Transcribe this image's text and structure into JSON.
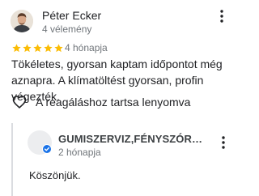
{
  "review": {
    "reviewer_name": "Péter Ecker",
    "review_count": "4 vélemény",
    "rating": 5,
    "rating_max": 5,
    "time_ago": "4 hónapja",
    "text": "Tökéletes, gyorsan kaptam időpontot még aznapra. A klímatöltést gyorsan, profin végezték.",
    "like_label": "A reagáláshoz tartsa lenyomva",
    "star_color": "#fbbc04"
  },
  "owner_reply": {
    "owner_name": "GUMISZERVIZ,FÉNYSZÓRÓ FEL…",
    "time_ago": "2 hónapja",
    "text": "Köszönjük.",
    "badge_color": "#1a73e8"
  },
  "icons": {
    "more": "more-vert-icon",
    "like": "heart-outline-icon",
    "star": "star-icon",
    "verified": "verified-badge-icon"
  }
}
